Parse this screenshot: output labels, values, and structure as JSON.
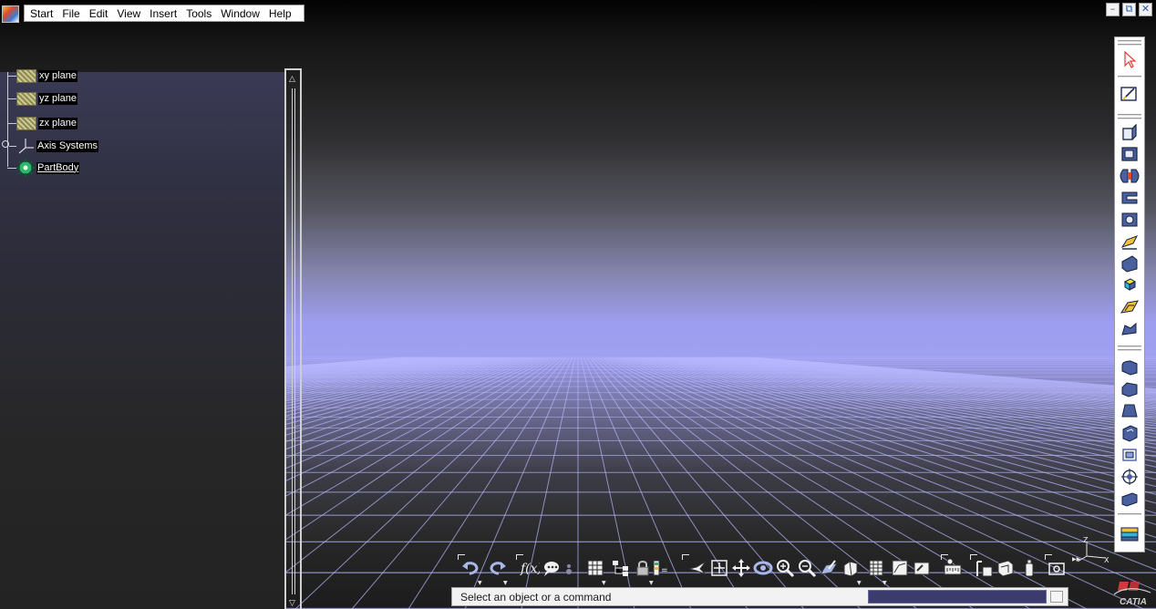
{
  "menubar": {
    "items": [
      "Start",
      "File",
      "Edit",
      "View",
      "Insert",
      "Tools",
      "Window",
      "Help"
    ]
  },
  "window_controls": {
    "minimize": "–",
    "restore": "⧉",
    "close": "✕"
  },
  "tree": {
    "items": [
      {
        "label": "xy plane",
        "icon": "plane-icon"
      },
      {
        "label": "yz plane",
        "icon": "plane-icon"
      },
      {
        "label": "zx plane",
        "icon": "plane-icon"
      },
      {
        "label": "Axis Systems",
        "icon": "axis-system-icon"
      },
      {
        "label": "PartBody",
        "icon": "gear-icon"
      }
    ]
  },
  "compass": {
    "z_label": "Z",
    "x_label": "X"
  },
  "status": {
    "prompt": "Select an object or a command"
  },
  "logo": {
    "text": "CATIA"
  },
  "colors": {
    "horizon": "#a0a0f0",
    "grid_lines": "#b8b8ff",
    "tree_label_bg": "#000000",
    "status_command_bg": "#3b3b6e"
  }
}
